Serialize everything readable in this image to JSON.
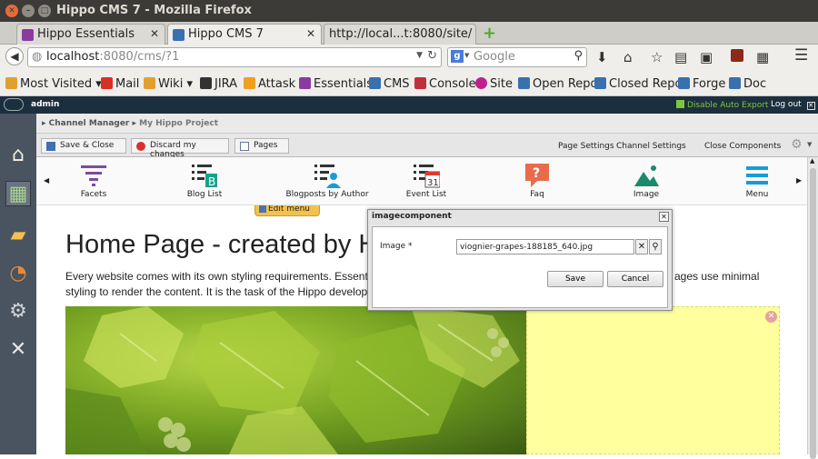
{
  "window": {
    "title": "Hippo CMS 7 - Mozilla Firefox"
  },
  "tabs": [
    {
      "label": "Hippo Essentials",
      "active": false
    },
    {
      "label": "Hippo CMS 7",
      "active": true
    },
    {
      "label": "http://local...t:8080/site/",
      "active": false
    }
  ],
  "nav": {
    "url_host": "localhost",
    "url_rest": ":8080/cms/?1",
    "search_placeholder": "Google"
  },
  "bookmarks": [
    {
      "label": "Most Visited",
      "icon": "bookmarks-icon",
      "color": "#e0a030"
    },
    {
      "label": "Mail",
      "icon": "gmail-icon",
      "color": "#d93025"
    },
    {
      "label": "Wiki",
      "icon": "folder-icon",
      "color": "#e0a030"
    },
    {
      "label": "JIRA",
      "icon": "jira-icon",
      "color": "#333333"
    },
    {
      "label": "Attask",
      "icon": "attask-icon",
      "color": "#f0a020"
    },
    {
      "label": "Essentials",
      "icon": "hippo-icon",
      "color": "#8a3ba0"
    },
    {
      "label": "CMS",
      "icon": "hippo-icon",
      "color": "#3a6fb0"
    },
    {
      "label": "Console",
      "icon": "hippo-icon",
      "color": "#c0303a"
    },
    {
      "label": "Site",
      "icon": "hippo-icon",
      "color": "#c02090"
    },
    {
      "label": "Open Repo",
      "icon": "hippo-icon",
      "color": "#3a6fb0"
    },
    {
      "label": "Closed Repo",
      "icon": "hippo-icon",
      "color": "#3a6fb0"
    },
    {
      "label": "Forge",
      "icon": "hippo-icon",
      "color": "#3a6fb0"
    },
    {
      "label": "Doc",
      "icon": "hippo-icon",
      "color": "#3a6fb0"
    }
  ],
  "cms_header": {
    "user": "admin",
    "auto_export": "Disable Auto Export",
    "logout": "Log out"
  },
  "breadcrumb": {
    "root": "Channel Manager",
    "current": "My Hippo Project"
  },
  "toolbar": {
    "save_close": "Save & Close",
    "discard": "Discard my changes",
    "pages": "Pages",
    "page_settings": "Page Settings",
    "channel_settings": "Channel Settings",
    "close_components": "Close Components"
  },
  "catalog": [
    {
      "label": "Facets",
      "icon": "facets-icon"
    },
    {
      "label": "Blog List",
      "icon": "blog-list-icon"
    },
    {
      "label": "Blogposts by Author",
      "icon": "author-icon"
    },
    {
      "label": "Event List",
      "icon": "calendar-icon",
      "day": "31"
    },
    {
      "label": "Faq",
      "icon": "faq-icon",
      "glyph": "?"
    },
    {
      "label": "Image",
      "icon": "image-icon"
    },
    {
      "label": "Menu",
      "icon": "menu-icon"
    }
  ],
  "page": {
    "edit_menu": "Edit menu",
    "heading": "Home Page - created by H",
    "paragraph_line1": "Every website comes with its own styling requirements. Essential",
    "paragraph_line1_right": "ages use minimal",
    "paragraph_line2": "styling to render the content. It is the task of the Hippo developer"
  },
  "dialog": {
    "title": "imagecomponent",
    "image_label": "Image *",
    "image_value": "viognier-grapes-188185_640.jpg",
    "save": "Save",
    "cancel": "Cancel"
  },
  "colors": {
    "cms_header": "#1c2f3e",
    "sidebar": "#4a5360",
    "image_placeholder": "#ffff9e",
    "catalog_accent": "#1a9bd7"
  }
}
